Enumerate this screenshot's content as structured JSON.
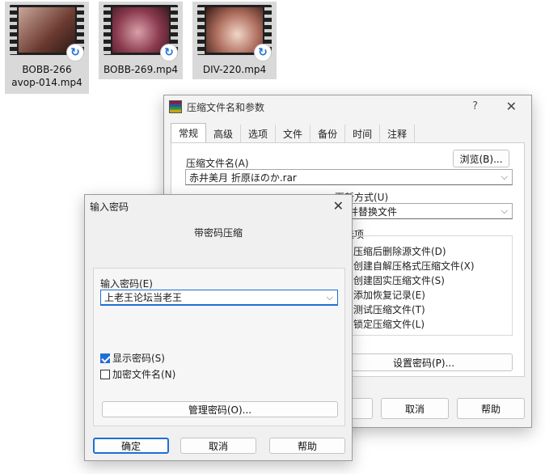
{
  "files": [
    {
      "name_line1": "BOBB-266",
      "name_line2": "avop-014.mp4",
      "selected": true,
      "thumb_color": "#8a5a4e"
    },
    {
      "name_line1": "BOBB-269.mp4",
      "name_line2": "",
      "selected": true,
      "thumb_color": "#8a3a4e"
    },
    {
      "name_line1": "DIV-220.mp4",
      "name_line2": "",
      "selected": true,
      "thumb_color": "#b07060"
    }
  ],
  "main_window": {
    "title": "压缩文件名和参数",
    "help_glyph": "?",
    "close_glyph": "✕",
    "tabs": [
      "常规",
      "高级",
      "选项",
      "文件",
      "备份",
      "时间",
      "注释"
    ],
    "archive_name_label": "压缩文件名(A)",
    "browse_button": "浏览(B)...",
    "archive_name_value": "赤井美月 折原ほのか.rar",
    "update_mode_label": "更新方式(U)",
    "update_mode_value": "加并替换文件",
    "options_group_label": "缩选项",
    "options": [
      "压缩后删除源文件(D)",
      "创建自解压格式压缩文件(X)",
      "创建固实压缩文件(S)",
      "添加恢复记录(E)",
      "测试压缩文件(T)",
      "锁定压缩文件(L)"
    ],
    "set_password_button": "设置密码(P)...",
    "cancel_button": "取消",
    "help_button": "帮助"
  },
  "password_dialog": {
    "title": "输入密码",
    "close_glyph": "✕",
    "heading": "带密码压缩",
    "password_label": "输入密码(E)",
    "password_value": "上老王论坛当老王",
    "show_password_label": "显示密码(S)",
    "show_password_checked": true,
    "encrypt_names_label": "加密文件名(N)",
    "encrypt_names_checked": false,
    "manage_button": "管理密码(O)...",
    "ok_button": "确定",
    "cancel_button": "取消",
    "help_button": "帮助"
  }
}
